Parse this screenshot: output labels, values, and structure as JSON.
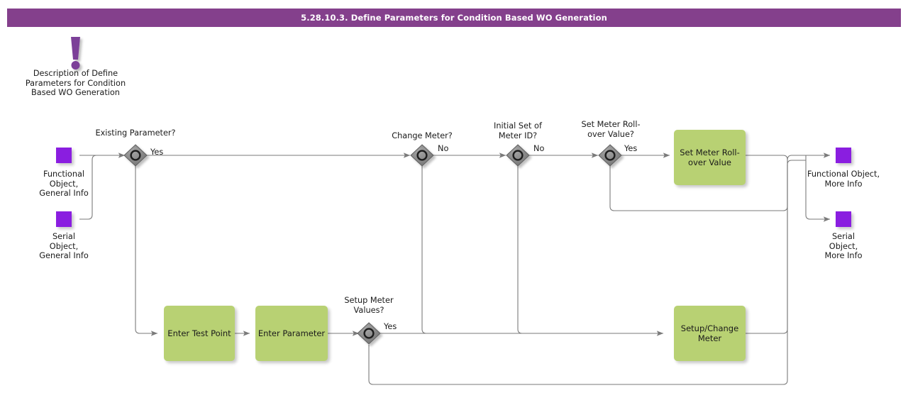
{
  "header": {
    "title": "5.28.10.3. Define Parameters for Condition Based WO Generation",
    "bar_color": "#84408c",
    "text_color": "#ffffff"
  },
  "colors": {
    "task_fill": "#b8d173",
    "endpoint_fill": "#8a1ee0",
    "gateway_fill": "#808080",
    "gateway_stroke": "#333333",
    "connector": "#7a7a7a",
    "annotation": "#7b3f98"
  },
  "annotation": {
    "icon": "exclamation-mark-icon",
    "text": "Description of Define\nParameters for Condition\nBased WO Generation"
  },
  "start_nodes": [
    {
      "id": "functional-object-general-info",
      "label": "Functional\nObject,\nGeneral Info"
    },
    {
      "id": "serial-object-general-info",
      "label": "Serial\nObject,\nGeneral Info"
    }
  ],
  "end_nodes": [
    {
      "id": "functional-object-more-info",
      "label": "Functional Object,\nMore Info"
    },
    {
      "id": "serial-object-more-info",
      "label": "Serial\nObject,\nMore Info"
    }
  ],
  "gateways": [
    {
      "id": "existing-parameter",
      "label": "Existing Parameter?",
      "edge_label": "Yes"
    },
    {
      "id": "change-meter",
      "label": "Change Meter?",
      "edge_label": "No"
    },
    {
      "id": "initial-set-of-meter-id",
      "label": "Initial Set of\nMeter ID?",
      "edge_label": "No"
    },
    {
      "id": "set-meter-rollover-value",
      "label": "Set Meter Roll-\nover Value?",
      "edge_label": "Yes"
    },
    {
      "id": "setup-meter-values",
      "label": "Setup Meter\nValues?",
      "edge_label": "Yes"
    }
  ],
  "tasks": [
    {
      "id": "enter-test-point",
      "label": "Enter Test Point"
    },
    {
      "id": "enter-parameter",
      "label": "Enter Parameter"
    },
    {
      "id": "set-meter-rollover-value-task",
      "label": "Set Meter Roll-\nover Value"
    },
    {
      "id": "setup-change-meter",
      "label": "Setup/Change\nMeter"
    }
  ]
}
